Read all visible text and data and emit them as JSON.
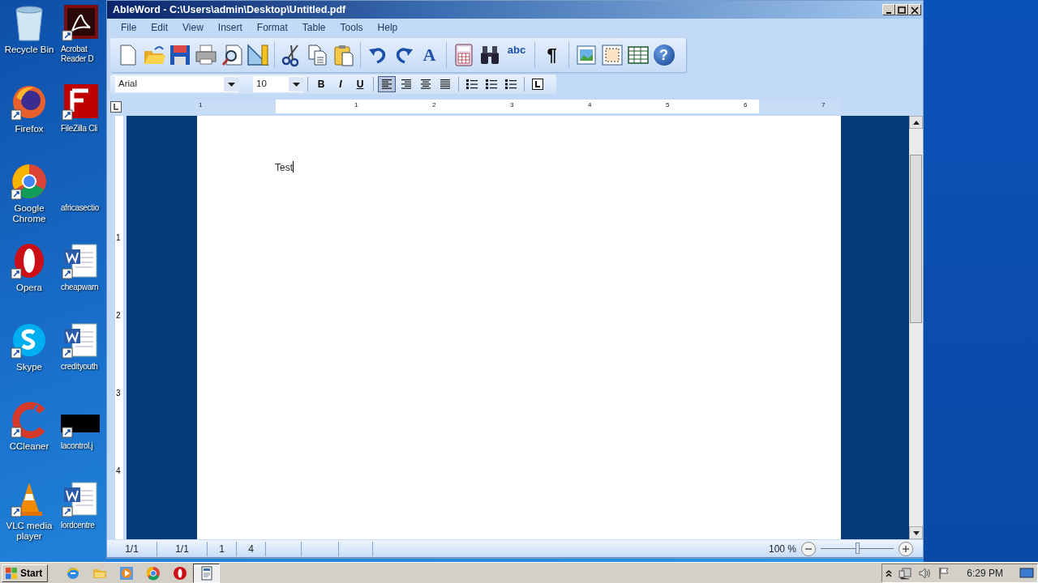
{
  "desktop": {
    "columns": [
      [
        {
          "label": "Recycle Bin",
          "kind": "recycle"
        },
        {
          "label": "Firefox",
          "kind": "firefox"
        },
        {
          "label": "Google Chrome",
          "kind": "chrome"
        },
        {
          "label": "Opera",
          "kind": "opera"
        },
        {
          "label": "Skype",
          "kind": "skype"
        },
        {
          "label": "CCleaner",
          "kind": "ccleaner"
        },
        {
          "label": "VLC media player",
          "kind": "vlc"
        }
      ],
      [
        {
          "label": "Acrobat Reader D",
          "kind": "pdf"
        },
        {
          "label": "FileZilla Cli",
          "kind": "filezilla"
        },
        {
          "label": "africasectio",
          "kind": "blank"
        },
        {
          "label": "cheapwarn",
          "kind": "word"
        },
        {
          "label": "credityouth",
          "kind": "word"
        },
        {
          "label": "lacontrol.j",
          "kind": "image"
        },
        {
          "label": "lordcentre",
          "kind": "word"
        }
      ]
    ]
  },
  "window": {
    "title": "AbleWord - C:\\Users\\admin\\Desktop\\Untitled.pdf",
    "menu": [
      "File",
      "Edit",
      "View",
      "Insert",
      "Format",
      "Table",
      "Tools",
      "Help"
    ],
    "toolbar": [
      {
        "kind": "new"
      },
      {
        "kind": "open"
      },
      {
        "kind": "save"
      },
      {
        "kind": "print"
      },
      {
        "kind": "preview"
      },
      {
        "kind": "ruler"
      },
      {
        "kind": "sep"
      },
      {
        "kind": "cut"
      },
      {
        "kind": "copy"
      },
      {
        "kind": "paste"
      },
      {
        "kind": "sep"
      },
      {
        "kind": "undo"
      },
      {
        "kind": "redo"
      },
      {
        "kind": "font",
        "label": "A"
      },
      {
        "kind": "sep"
      },
      {
        "kind": "calc"
      },
      {
        "kind": "find"
      },
      {
        "kind": "spell",
        "label": "abc"
      },
      {
        "kind": "sep"
      },
      {
        "kind": "pilcrow",
        "label": "¶"
      },
      {
        "kind": "sep"
      },
      {
        "kind": "image"
      },
      {
        "kind": "frame"
      },
      {
        "kind": "table"
      },
      {
        "kind": "help",
        "label": "?"
      }
    ],
    "format_bar": {
      "font": "Arial",
      "size": "10",
      "buttons": [
        {
          "kind": "bold",
          "label": "B",
          "selected": false
        },
        {
          "kind": "italic",
          "label": "I",
          "selected": false
        },
        {
          "kind": "underline",
          "label": "U",
          "selected": false
        },
        {
          "kind": "sep"
        },
        {
          "kind": "align-left",
          "selected": true
        },
        {
          "kind": "align-right",
          "selected": false
        },
        {
          "kind": "align-center",
          "selected": false
        },
        {
          "kind": "justify",
          "selected": false
        },
        {
          "kind": "sep"
        },
        {
          "kind": "numbered",
          "selected": false
        },
        {
          "kind": "bullets",
          "selected": false
        },
        {
          "kind": "multilevel",
          "selected": false
        },
        {
          "kind": "sep"
        },
        {
          "kind": "tabstop",
          "selected": false
        }
      ]
    },
    "ruler": {
      "labels": [
        "1",
        "1",
        "2",
        "3",
        "4",
        "5",
        "6",
        "7"
      ]
    },
    "vertical_ruler": {
      "labels": [
        "1",
        "2",
        "3",
        "4"
      ]
    },
    "document": {
      "text": "Test"
    },
    "status_bar": {
      "cells": [
        "1/1",
        "1/1",
        "1",
        "4"
      ]
    },
    "zoom": {
      "reading": "100 %",
      "level": 0.5
    }
  },
  "taskbar": {
    "start": "Start",
    "apps": [
      {
        "kind": "ie",
        "selected": false
      },
      {
        "kind": "explorer",
        "selected": false
      },
      {
        "kind": "media",
        "selected": false
      },
      {
        "kind": "chrome",
        "selected": false
      },
      {
        "kind": "opera",
        "selected": false
      },
      {
        "kind": "ableword",
        "selected": true
      }
    ],
    "clock": "6:29 PM"
  }
}
